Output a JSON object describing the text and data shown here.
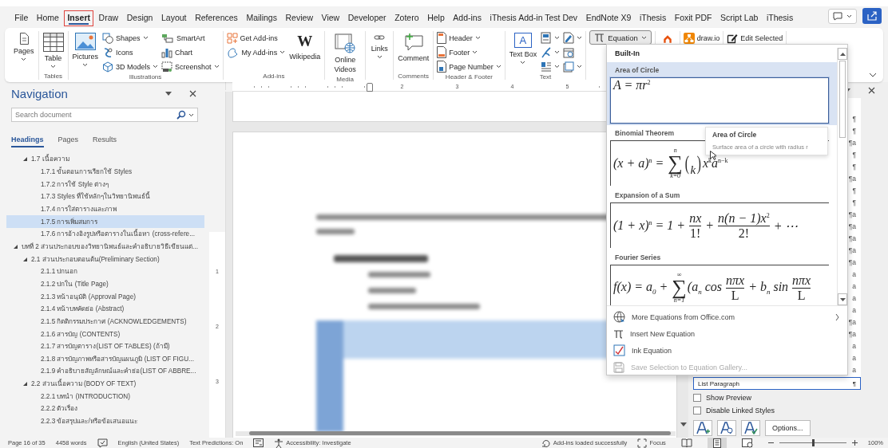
{
  "menu_tabs": [
    {
      "label": "File",
      "selected": false,
      "annotated": false
    },
    {
      "label": "Home",
      "selected": false,
      "annotated": false
    },
    {
      "label": "Insert",
      "selected": true,
      "annotated": true
    },
    {
      "label": "Draw",
      "selected": false,
      "annotated": false
    },
    {
      "label": "Design",
      "selected": false,
      "annotated": false
    },
    {
      "label": "Layout",
      "selected": false,
      "annotated": false
    },
    {
      "label": "References",
      "selected": false,
      "annotated": false
    },
    {
      "label": "Mailings",
      "selected": false,
      "annotated": false
    },
    {
      "label": "Review",
      "selected": false,
      "annotated": false
    },
    {
      "label": "View",
      "selected": false,
      "annotated": false
    },
    {
      "label": "Developer",
      "selected": false,
      "annotated": false
    },
    {
      "label": "Zotero",
      "selected": false,
      "annotated": false
    },
    {
      "label": "Help",
      "selected": false,
      "annotated": false
    },
    {
      "label": "Add-ins",
      "selected": false,
      "annotated": false
    },
    {
      "label": "iThesis Add-in Test Dev",
      "selected": false,
      "annotated": false
    },
    {
      "label": "EndNote X9",
      "selected": false,
      "annotated": false
    },
    {
      "label": "iThesis",
      "selected": false,
      "annotated": false
    },
    {
      "label": "Foxit PDF",
      "selected": false,
      "annotated": false
    },
    {
      "label": "Script Lab",
      "selected": false,
      "annotated": false
    },
    {
      "label": "iThesis",
      "selected": false,
      "annotated": false
    }
  ],
  "ribbon": {
    "groups": [
      {
        "items": [
          {
            "kind": "large",
            "label": "Pages",
            "caret": true
          }
        ]
      },
      {
        "label": "Tables",
        "items": [
          {
            "kind": "large",
            "label": "Table",
            "caret": true
          }
        ]
      },
      {
        "label": "Illustrations",
        "items": [
          {
            "kind": "large",
            "label": "Pictures",
            "caret": true
          },
          {
            "kind": "stack",
            "rows": [
              {
                "label": "Shapes",
                "caret": true
              },
              {
                "label": "Icons",
                "caret": false
              },
              {
                "label": "3D Models",
                "caret": true
              }
            ]
          },
          {
            "kind": "stack",
            "rows": [
              {
                "label": "SmartArt",
                "caret": false
              },
              {
                "label": "Chart",
                "caret": false
              },
              {
                "label": "Screenshot",
                "caret": true
              }
            ]
          }
        ]
      },
      {
        "label": "Add-ins",
        "items": [
          {
            "kind": "stack",
            "rows": [
              {
                "label": "Get Add-ins",
                "caret": false
              },
              {
                "label": "My Add-ins",
                "caret": true
              }
            ]
          },
          {
            "kind": "large",
            "label": "Wikipedia",
            "caret": false,
            "glyph": "W"
          }
        ]
      },
      {
        "label": "Media",
        "items": [
          {
            "kind": "large",
            "label": "Online Videos",
            "caret": false
          }
        ]
      },
      {
        "items": [
          {
            "kind": "large",
            "label": "Links",
            "caret": true
          }
        ]
      },
      {
        "label": "Comments",
        "items": [
          {
            "kind": "large",
            "label": "Comment",
            "caret": false
          }
        ]
      },
      {
        "label": "Header & Footer",
        "items": [
          {
            "kind": "stack",
            "rows": [
              {
                "label": "Header",
                "caret": true
              },
              {
                "label": "Footer",
                "caret": true
              },
              {
                "label": "Page Number",
                "caret": true
              }
            ]
          }
        ]
      },
      {
        "label": "Text",
        "items": [
          {
            "kind": "large",
            "label": "Text Box",
            "caret": true,
            "glyph": "A"
          },
          {
            "kind": "stack",
            "rows": [
              {
                "caret": true
              },
              {
                "caret": true
              },
              {
                "caret": true
              }
            ]
          },
          {
            "kind": "stack",
            "rows": [
              {
                "caret": true
              },
              {
                "caret": false
              },
              {
                "caret": true
              }
            ]
          }
        ]
      },
      {
        "items": [
          {
            "kind": "dropdown",
            "label": "Equation",
            "expanded": true
          }
        ]
      },
      {
        "items": [
          {
            "kind": "large",
            "caret": false
          }
        ]
      },
      {
        "items": [
          {
            "kind": "stack",
            "rows": [
              {
                "label": "draw.io",
                "caret": false
              }
            ]
          }
        ]
      },
      {
        "items": [
          {
            "kind": "stack",
            "rows": [
              {
                "label": "Edit Selected",
                "caret": false
              }
            ]
          }
        ]
      }
    ]
  },
  "navigation": {
    "title": "Navigation",
    "search": {
      "placeholder": "Search document"
    },
    "tabs": [
      {
        "label": "Headings",
        "selected": true
      },
      {
        "label": "Pages",
        "selected": false
      },
      {
        "label": "Results",
        "selected": false
      }
    ],
    "headings": [
      {
        "children": [
          {
            "label": "1.7 เนื้อความ",
            "expanded": true,
            "selected": false,
            "children": [
              {
                "label": "1.7.1 ขั้นตอนการเรียกใช้ Styles",
                "selected": false
              },
              {
                "label": "1.7.2 การใช้ Style ต่างๆ",
                "selected": false
              },
              {
                "label": "1.7.3 Styles ที่ใช้หลักๆในวิทยานิพนธ์นี้",
                "selected": false
              },
              {
                "label": "1.7.4 การใส่ตารางและภาพ",
                "selected": false
              },
              {
                "label": "1.7.5 การเพิ่มสมการ",
                "selected": true
              },
              {
                "label": "1.7.6 การอ้างอิงรูปหรือตารางในเนื้อหา (cross-refere...",
                "selected": false
              }
            ]
          }
        ]
      },
      {
        "label": "บทที่ 2  ส่วนประกอบของวิทยานิพนธ์และคำอธิบายวิธีเขียนแต่...",
        "expanded": true,
        "selected": false,
        "children": [
          {
            "label": "2.1 ส่วนประกอบตอนต้น(Preliminary Section)",
            "expanded": true,
            "selected": false,
            "children": [
              {
                "label": "2.1.1 ปกนอก",
                "selected": false
              },
              {
                "label": "2.1.2 ปกใน (Title Page)",
                "selected": false
              },
              {
                "label": "2.1.3 หน้าอนุมัติ (Approval Page)",
                "selected": false
              },
              {
                "label": "2.1.4 หน้าบทคัดย่อ (Abstract)",
                "selected": false
              },
              {
                "label": "2.1.5 กิตติกรรมประกาศ (ACKNOWLEDGEMENTS)",
                "selected": false
              },
              {
                "label": "2.1.6 สารบัญ (CONTENTS)",
                "selected": false
              },
              {
                "label": "2.1.7 สารบัญตาราง(LIST OF TABLES) (ถ้ามี)",
                "selected": false
              },
              {
                "label": "2.1.8 สารบัญภาพหรือสารบัญแผนภูมิ (LIST OF FIGU...",
                "selected": false
              },
              {
                "label": "2.1.9 คำอธิบายสัญลักษณ์และคำย่อ(LIST OF ABBRE...",
                "selected": false
              }
            ]
          },
          {
            "label": "2.2 ส่วนเนื้อความ (BODY OF TEXT)",
            "expanded": true,
            "selected": false,
            "children": [
              {
                "label": "2.2.1 บทนำ (INTRODUCTION)",
                "selected": false
              },
              {
                "label": "2.2.2 ตัวเรื่อง",
                "selected": false
              },
              {
                "label": "2.2.3 ข้อสรุปและ/หรือข้อเสนอแนะ",
                "selected": false
              }
            ]
          }
        ]
      }
    ]
  },
  "document": {
    "ruler_numbers": [
      "2",
      "3",
      "4",
      "5"
    ],
    "vertical_ruler_numbers": [
      "1",
      "2",
      "3"
    ]
  },
  "equation_gallery": {
    "heading": "Built-In",
    "items": [
      {
        "name": "Area of Circle",
        "selected": true,
        "parts": [
          {
            "kind": "text",
            "text": "A = πr$^{2}$"
          }
        ]
      },
      {
        "name": "Binomial Theorem",
        "selected": false,
        "parts": [
          {
            "kind": "text",
            "text": "(x + a)$^{n}$ = "
          },
          {
            "kind": "sum",
            "symbol": "∑",
            "upper": "n",
            "lower": "k=0"
          },
          {
            "kind": "binom",
            "open": "(",
            "close": ")",
            "bottom": "k"
          },
          {
            "kind": "text",
            "text": "x$^{k}$a$^{n−k}$"
          }
        ]
      },
      {
        "name": "Expansion of a Sum",
        "selected": false,
        "parts": [
          {
            "kind": "text",
            "text": "(1 + x)$^{n}$ = 1 + "
          },
          {
            "kind": "frac",
            "num": "nx",
            "den": "1!"
          },
          {
            "kind": "text",
            "text": " + "
          },
          {
            "kind": "frac",
            "num": "n(n − 1)x$^{2}$",
            "den": "2!"
          },
          {
            "kind": "text",
            "text": " + ⋯"
          }
        ]
      },
      {
        "name": "Fourier Series",
        "selected": false,
        "parts": [
          {
            "kind": "text",
            "text": "f(x) = a$_{0}$ + "
          },
          {
            "kind": "sum",
            "symbol": "∑",
            "upper": "∞",
            "lower": "n=1"
          },
          {
            "kind": "text",
            "text": "(a$_{n}$ cos "
          },
          {
            "kind": "frac",
            "num": "nπx",
            "den": "L"
          },
          {
            "kind": "text",
            "text": " + b$_{n}$ sin "
          },
          {
            "kind": "frac",
            "num": "nπx",
            "den": "L"
          }
        ]
      }
    ],
    "commands": [
      {
        "label": "More Equations from Office.com",
        "disabled": false,
        "submenu": true
      },
      {
        "label": "Insert New Equation",
        "disabled": false,
        "submenu": false
      },
      {
        "label": "Ink Equation",
        "disabled": false,
        "submenu": false
      },
      {
        "label": "Save Selection to Equation Gallery...",
        "disabled": true,
        "submenu": false
      }
    ],
    "tooltip": {
      "title": "Area of Circle",
      "description": "Surface area of a circle with radius r"
    }
  },
  "styles_pane": {
    "marks": [
      {
        "glyph": "¶"
      },
      {
        "glyph": "¶"
      },
      {
        "glyph": "¶a"
      },
      {
        "glyph": "¶"
      },
      {
        "glyph": "¶"
      },
      {
        "glyph": "¶a"
      },
      {
        "glyph": "¶"
      },
      {
        "glyph": "¶"
      },
      {
        "glyph": "¶a"
      },
      {
        "glyph": "¶a"
      },
      {
        "glyph": "¶a"
      },
      {
        "glyph": "¶a"
      },
      {
        "glyph": "¶a"
      },
      {
        "glyph": "a"
      },
      {
        "glyph": "a"
      },
      {
        "glyph": "a"
      },
      {
        "glyph": "a"
      },
      {
        "glyph": "¶a"
      },
      {
        "glyph": "¶a"
      },
      {
        "glyph": "a"
      },
      {
        "glyph": "a"
      },
      {
        "glyph": "a"
      }
    ],
    "current": {
      "label": "List Paragraph",
      "glyph": "¶",
      "selected": true
    },
    "options": [
      {
        "label": "Show Preview",
        "checked": false
      },
      {
        "label": "Disable Linked Styles",
        "checked": false
      }
    ],
    "buttons": [
      {
        "kind": "icon"
      },
      {
        "kind": "icon"
      },
      {
        "kind": "icon"
      },
      {
        "kind": "text",
        "label": "Options..."
      }
    ]
  },
  "status_left": [
    {
      "kind": "text",
      "label": "Page 16 of 35"
    },
    {
      "kind": "text",
      "label": "4458 words"
    },
    {
      "kind": "icon"
    },
    {
      "kind": "text",
      "label": "English (United States)"
    },
    {
      "kind": "text",
      "label": "Text Predictions: On"
    },
    {
      "kind": "icon"
    },
    {
      "kind": "icon_text",
      "label": "Accessibility: Investigate"
    }
  ],
  "status_right": [
    {
      "kind": "icon_text",
      "label": "Add-ins loaded successfully"
    },
    {
      "kind": "icon_text",
      "label": "Focus"
    }
  ],
  "views": [
    {
      "selected": false
    },
    {
      "selected": true
    },
    {
      "selected": false
    }
  ],
  "zoom": {
    "level": 0.5,
    "reading": "100%"
  }
}
